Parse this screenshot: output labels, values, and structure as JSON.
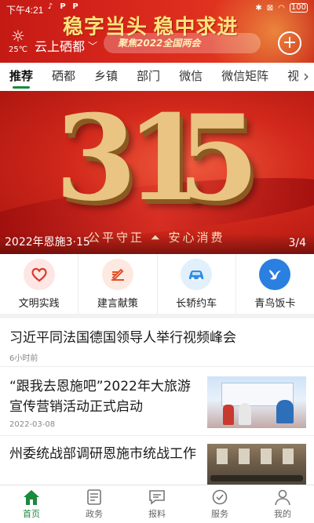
{
  "status_bar": {
    "time": "下午4:21",
    "app_icons": [
      "♪",
      "P",
      "P"
    ],
    "battery": "100"
  },
  "header": {
    "slogan": "稳字当头 稳中求进",
    "sub_slogan": "聚焦2022全国两会",
    "temperature": "25℃",
    "location": "云上硒都",
    "add_button": "+"
  },
  "tabs": [
    {
      "label": "推荐",
      "active": true
    },
    {
      "label": "硒都"
    },
    {
      "label": "乡镇"
    },
    {
      "label": "部门"
    },
    {
      "label": "微信"
    },
    {
      "label": "微信矩阵"
    },
    {
      "label": "视"
    }
  ],
  "hero": {
    "digits": [
      "3",
      "1",
      "5"
    ],
    "caption_art": "公平守正 ⏶ 安心消费",
    "title": "2022年恩施3·15",
    "page_indicator": "3/4"
  },
  "shortcuts": [
    {
      "label": "文明实践",
      "icon": "heart-icon",
      "bg": "#fde6e3",
      "color": "#d93a2c"
    },
    {
      "label": "建言献策",
      "icon": "pen-icon",
      "bg": "#fde9df",
      "color": "#e0502b"
    },
    {
      "label": "长轿约车",
      "icon": "car-icon",
      "bg": "#e2f0fb",
      "color": "#2f8de4"
    },
    {
      "label": "青鸟饭卡",
      "icon": "bird-icon",
      "bg": "#2a7fe0",
      "color": "#ffffff"
    }
  ],
  "news": [
    {
      "title": "习近平同法国德国领导人举行视频峰会",
      "time": "6小时前"
    },
    {
      "title": "“跟我去恩施吧”2022年大旅游宣传营销活动正式启动",
      "time": "2022-03-08"
    },
    {
      "title": "州委统战部调研恩施市统战工作",
      "time": ""
    }
  ],
  "bottom_nav": [
    {
      "label": "首页",
      "icon": "home-icon",
      "active": true
    },
    {
      "label": "政务",
      "icon": "document-icon"
    },
    {
      "label": "报料",
      "icon": "chat-icon"
    },
    {
      "label": "服务",
      "icon": "service-icon"
    },
    {
      "label": "我的",
      "icon": "profile-icon"
    }
  ],
  "colors": {
    "accent": "#1a8a3d",
    "header_red": "#d8261c"
  }
}
